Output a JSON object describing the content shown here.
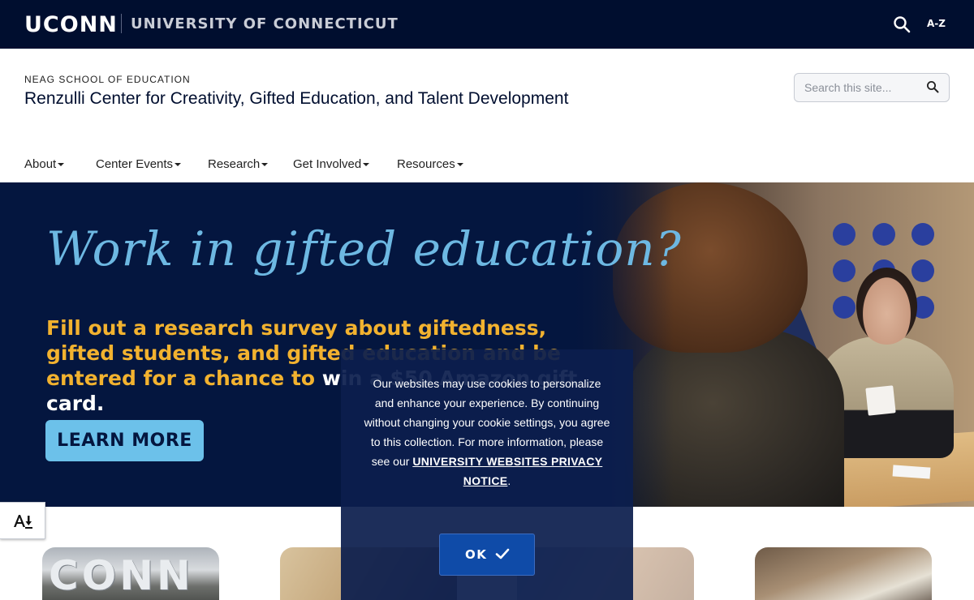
{
  "topbar": {
    "wordmark": "UCONN",
    "university_name": "UNIVERSITY OF CONNECTICUT",
    "search_icon": "search-icon",
    "az_label": "A-Z"
  },
  "header": {
    "school": "NEAG SCHOOL OF EDUCATION",
    "site_title": "Renzulli Center for Creativity, Gifted Education, and Talent Development",
    "search_placeholder": "Search this site..."
  },
  "nav": {
    "items": [
      {
        "label": "About"
      },
      {
        "label": "Center Events"
      },
      {
        "label": "Research"
      },
      {
        "label": "Get Involved"
      },
      {
        "label": "Resources"
      }
    ]
  },
  "hero": {
    "headline": "Work in gifted education?",
    "body_part1": "Fill out a research survey about giftedness, gifted students, and gifted education and be entered for a chance to ",
    "body_part2": "win a $50 Amazon gift card.",
    "cta_label": "LEARN MORE"
  },
  "accessibility": {
    "icon": "accessibility-download-icon"
  },
  "cookie_banner": {
    "text": "Our websites may use cookies to personalize and enhance your experience. By continuing without changing your cookie settings, you agree to this collection. For more information, please see our ",
    "link_label": "UNIVERSITY WEBSITES PRIVACY NOTICE",
    "after_link": ".",
    "ok_label": "OK"
  },
  "cards": [
    {
      "sign_text": "CONN"
    },
    {},
    {},
    {}
  ],
  "colors": {
    "topbar_bg": "#000e2f",
    "hero_bg": "#04163f",
    "hero_script": "#6db8e2",
    "hero_body": "#f2b22f",
    "cta_bg": "#6cc1ea",
    "cookie_bg": "#0c1e4d",
    "ok_button_bg": "#0f4ba8"
  }
}
